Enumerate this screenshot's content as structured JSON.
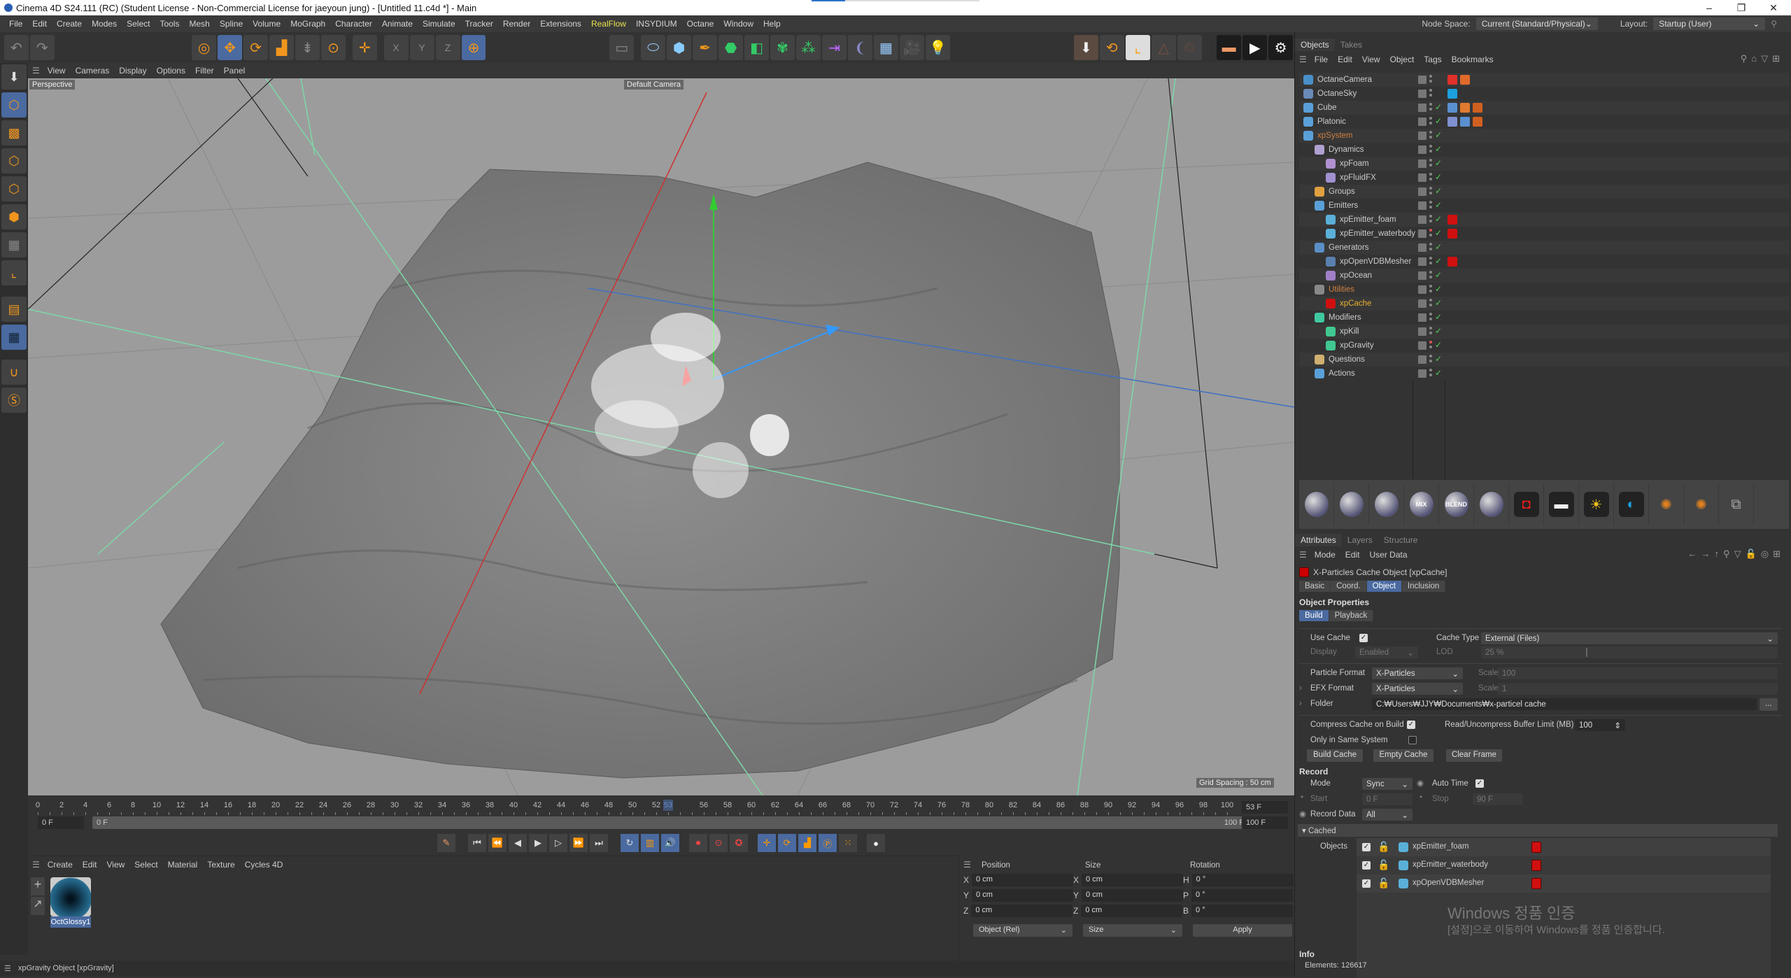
{
  "window": {
    "title": "Cinema 4D S24.111 (RC) (Student License - Non-Commercial License for jaeyoun jung) - [Untitled 11.c4d *] - Main",
    "controls": [
      "minimize",
      "maximize",
      "close"
    ]
  },
  "menubar": {
    "items": [
      "File",
      "Edit",
      "Create",
      "Modes",
      "Select",
      "Tools",
      "Mesh",
      "Spline",
      "Volume",
      "MoGraph",
      "Character",
      "Animate",
      "Simulate",
      "Tracker",
      "Render",
      "Extensions",
      "RealFlow",
      "INSYDIUM",
      "Octane",
      "Window",
      "Help"
    ],
    "highlighted": "RealFlow",
    "node_space_label": "Node Space:",
    "node_space_value": "Current (Standard/Physical)",
    "layout_label": "Layout:",
    "layout_value": "Startup (User)"
  },
  "toolbar": {
    "icons": [
      "undo-icon",
      "redo-icon",
      "select-tool-icon",
      "move-tool-icon",
      "rotate-tool-icon",
      "scale-tool-icon",
      "live-selection-icon",
      "transform-icon",
      "axis-icon",
      "x-axis-lock-icon",
      "y-axis-lock-icon",
      "z-axis-lock-icon",
      "world-coordinates-icon",
      "null-object-icon",
      "spline-icon",
      "cube-icon",
      "pen-icon",
      "subdivision-icon",
      "extrude-icon",
      "cloner-icon",
      "mograph-icon",
      "deformer-icon",
      "field-icon",
      "floor-icon",
      "camera-icon",
      "light-icon",
      "drop-to-floor-icon",
      "snap-icon",
      "axis-center-icon",
      "disabled-icon",
      "recycle-icon",
      "render-view-icon",
      "render-picture-viewer-icon",
      "render-settings-icon"
    ]
  },
  "left_tools": [
    "make-editable-icon",
    "model-mode-icon",
    "texture-mode-icon",
    "point-mode-icon",
    "edge-mode-icon",
    "polygon-mode-icon",
    "uv-mode-icon",
    "axis-mode-icon",
    "workplane-icon",
    "locked-workplane-icon",
    "snap-magnet-icon",
    "solo-icon"
  ],
  "viewport": {
    "menu": [
      "View",
      "Cameras",
      "Display",
      "Options",
      "Filter",
      "Panel"
    ],
    "label": "Perspective",
    "camera": "Default Camera",
    "grid_spacing": "Grid Spacing : 50 cm"
  },
  "timeline": {
    "ticks": [
      "0",
      "2",
      "4",
      "6",
      "8",
      "10",
      "12",
      "14",
      "16",
      "18",
      "20",
      "22",
      "24",
      "26",
      "28",
      "30",
      "32",
      "34",
      "36",
      "38",
      "40",
      "42",
      "44",
      "46",
      "48",
      "50",
      "52",
      "53",
      "56",
      "58",
      "60",
      "62",
      "64",
      "66",
      "68",
      "70",
      "72",
      "74",
      "76",
      "78",
      "80",
      "82",
      "84",
      "86",
      "88",
      "90",
      "92",
      "94",
      "96",
      "98",
      "100"
    ],
    "current_frame": 53,
    "max_frame": 100,
    "current_field": "53 F",
    "start_field": "0 F",
    "range_start": "0 F",
    "range_end": "100 F",
    "end_field": "100 F"
  },
  "playback": {
    "buttons": [
      "keyframe-icon",
      "goto-start-icon",
      "prev-key-icon",
      "prev-frame-icon",
      "play-icon",
      "next-frame-icon",
      "next-key-icon",
      "goto-end-icon",
      "loop-icon",
      "film-icon",
      "sound-icon",
      "record-icon",
      "autokey-icon",
      "keyframe-selection-icon",
      "position-key-icon",
      "rotation-key-icon",
      "scale-key-icon",
      "param-key-icon",
      "point-level-icon",
      "motion-clip-icon"
    ]
  },
  "material_manager": {
    "menu": [
      "Create",
      "Edit",
      "View",
      "Select",
      "Material",
      "Texture",
      "Cycles 4D"
    ],
    "materials": [
      {
        "name": "OctGlossy1"
      }
    ]
  },
  "coordinates": {
    "headers": [
      "Position",
      "Size",
      "Rotation"
    ],
    "position": [
      {
        "axis": "X",
        "value": "0 cm"
      },
      {
        "axis": "Y",
        "value": "0 cm"
      },
      {
        "axis": "Z",
        "value": "0 cm"
      }
    ],
    "size": [
      {
        "axis": "X",
        "value": "0 cm"
      },
      {
        "axis": "Y",
        "value": "0 cm"
      },
      {
        "axis": "Z",
        "value": "0 cm"
      }
    ],
    "rotation": [
      {
        "axis": "H",
        "value": "0 °"
      },
      {
        "axis": "P",
        "value": "0 °"
      },
      {
        "axis": "B",
        "value": "0 °"
      }
    ],
    "mode": "Object (Rel)",
    "size_mode": "Size",
    "apply": "Apply"
  },
  "statusbar": {
    "text": "xpGravity Object [xpGravity]"
  },
  "objects_panel": {
    "tabs": [
      "Objects",
      "Takes"
    ],
    "menu": [
      "File",
      "Edit",
      "View",
      "Object",
      "Tags",
      "Bookmarks"
    ],
    "items": [
      {
        "name": "OctaneCamera",
        "depth": 0,
        "color": "#4a90c8"
      },
      {
        "name": "OctaneSky",
        "depth": 0,
        "color": "#6a8ab8"
      },
      {
        "name": "Cube",
        "depth": 0,
        "color": "#5aa0d8"
      },
      {
        "name": "Platonic",
        "depth": 0,
        "color": "#5aa0d8"
      },
      {
        "name": "xpSystem",
        "depth": 0,
        "color": "#5aa0d8",
        "style": "orange"
      },
      {
        "name": "Dynamics",
        "depth": 1,
        "color": "#b0a0d0"
      },
      {
        "name": "xpFoam",
        "depth": 2,
        "color": "#b090d0"
      },
      {
        "name": "xpFluidFX",
        "depth": 2,
        "color": "#a090d0"
      },
      {
        "name": "Groups",
        "depth": 1,
        "color": "#e0a040"
      },
      {
        "name": "Emitters",
        "depth": 1,
        "color": "#5aa0d8"
      },
      {
        "name": "xpEmitter_foam",
        "depth": 2,
        "color": "#5ab0d8"
      },
      {
        "name": "xpEmitter_waterbody",
        "depth": 2,
        "color": "#5ab0d8"
      },
      {
        "name": "Generators",
        "depth": 1,
        "color": "#5a90c8"
      },
      {
        "name": "xpOpenVDBMesher",
        "depth": 2,
        "color": "#5a80b0"
      },
      {
        "name": "xpOcean",
        "depth": 2,
        "color": "#a080c8"
      },
      {
        "name": "Utilities",
        "depth": 1,
        "color": "#888",
        "style": "orange"
      },
      {
        "name": "xpCache",
        "depth": 2,
        "color": "#d01010",
        "style": "yellow"
      },
      {
        "name": "Modifiers",
        "depth": 1,
        "color": "#40c8a0"
      },
      {
        "name": "xpKill",
        "depth": 2,
        "color": "#40c890"
      },
      {
        "name": "xpGravity",
        "depth": 2,
        "color": "#40c890"
      },
      {
        "name": "Questions",
        "depth": 1,
        "color": "#d0b070"
      },
      {
        "name": "Actions",
        "depth": 1,
        "color": "#5aa0d8"
      }
    ]
  },
  "octane_presets": [
    "diffuse-material-icon",
    "glossy-material-icon",
    "specular-material-icon",
    "MIX",
    "BLEND",
    "metal-material-icon",
    "octane-camera-icon",
    "area-light-icon",
    "daylight-icon",
    "octane-sky-icon",
    "vdb-explosion-icon",
    "vdb-fire-icon",
    "node-editor-icon"
  ],
  "attributes": {
    "tabs": [
      "Attributes",
      "Layers",
      "Structure"
    ],
    "menu": [
      "Mode",
      "Edit",
      "User Data"
    ],
    "object_title": "X-Particles Cache Object [xpCache]",
    "subtabs": [
      "Basic",
      "Coord.",
      "Object",
      "Inclusion"
    ],
    "active_subtab": "Object",
    "section": "Object Properties",
    "build_tabs": [
      "Build",
      "Playback"
    ],
    "use_cache_label": "Use Cache",
    "use_cache": true,
    "cache_type_label": "Cache Type",
    "cache_type": "External (Files)",
    "display_label": "Display",
    "display_value": "Enabled",
    "lod_label": "LOD",
    "lod_value": "25 %",
    "lod_fraction": 0.25,
    "particle_format_label": "Particle Format",
    "particle_format": "X-Particles",
    "efx_format_label": "EFX Format",
    "efx_format": "X-Particles",
    "scale_label": "Scale",
    "particle_scale": "100",
    "efx_scale": "1",
    "folder_label": "Folder",
    "folder": "C:₩Users₩JJY₩Documents₩x-particel cache",
    "folder_btn": "...",
    "compress_label": "Compress Cache on Build",
    "compress": true,
    "buffer_label": "Read/Uncompress Buffer Limit (MB)",
    "buffer_value": "100",
    "same_system_label": "Only in Same System",
    "same_system": false,
    "build_cache": "Build Cache",
    "empty_cache": "Empty Cache",
    "clear_frame": "Clear Frame",
    "record_section": "Record",
    "mode_label": "Mode",
    "mode_value": "Sync",
    "auto_time_label": "Auto Time",
    "auto_time": true,
    "start_label": "Start",
    "start_value": "0 F",
    "stop_label": "Stop",
    "stop_value": "90 F",
    "record_data_label": "Record Data",
    "record_data_value": "All",
    "cached_label": "Cached",
    "objects_label": "Objects",
    "cached_objects": [
      {
        "name": "xpEmitter_foam",
        "enabled": true
      },
      {
        "name": "xpEmitter_waterbody",
        "enabled": true
      },
      {
        "name": "xpOpenVDBMesher",
        "enabled": true
      }
    ],
    "watermark_title": "Windows 정품 인증",
    "watermark_sub": "[설정]으로 이동하여 Windows를 정품 인증합니다.",
    "info_label": "Info",
    "elements": "Elements: 126617"
  }
}
